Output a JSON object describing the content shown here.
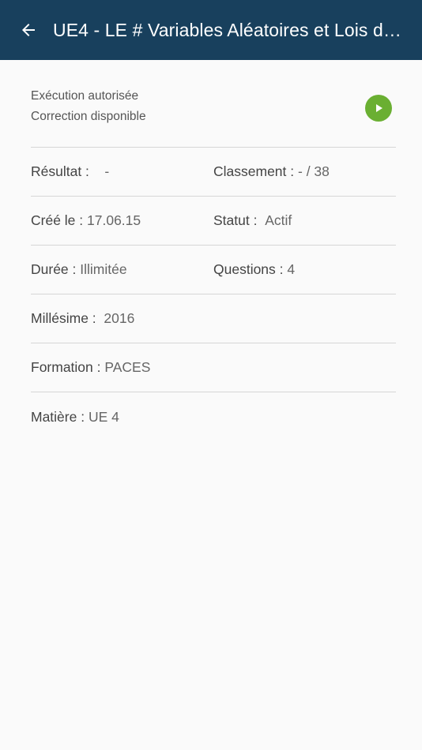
{
  "appbar": {
    "title": "UE4 - LE # Variables Aléatoires et Lois de ..."
  },
  "status": {
    "line1": "Exécution autorisée",
    "line2": "Correction disponible"
  },
  "details": {
    "resultat": {
      "label": "Résultat :",
      "value": "-"
    },
    "classement": {
      "label": "Classement :",
      "value": "- / 38"
    },
    "cree": {
      "label": "Créé le :",
      "value": "17.06.15"
    },
    "statut": {
      "label": "Statut :",
      "value": "Actif"
    },
    "duree": {
      "label": "Durée :",
      "value": "Illimitée"
    },
    "questions": {
      "label": "Questions :",
      "value": "4"
    },
    "millesime": {
      "label": "Millésime :",
      "value": "2016"
    },
    "formation": {
      "label": "Formation :",
      "value": "PACES"
    },
    "matiere": {
      "label": "Matière :",
      "value": "UE 4"
    }
  },
  "colors": {
    "appbar": "#18405d",
    "play_button": "#6aaf32",
    "background": "#fafafa"
  },
  "icons": {
    "back": "arrow-left-icon",
    "play": "play-icon"
  }
}
